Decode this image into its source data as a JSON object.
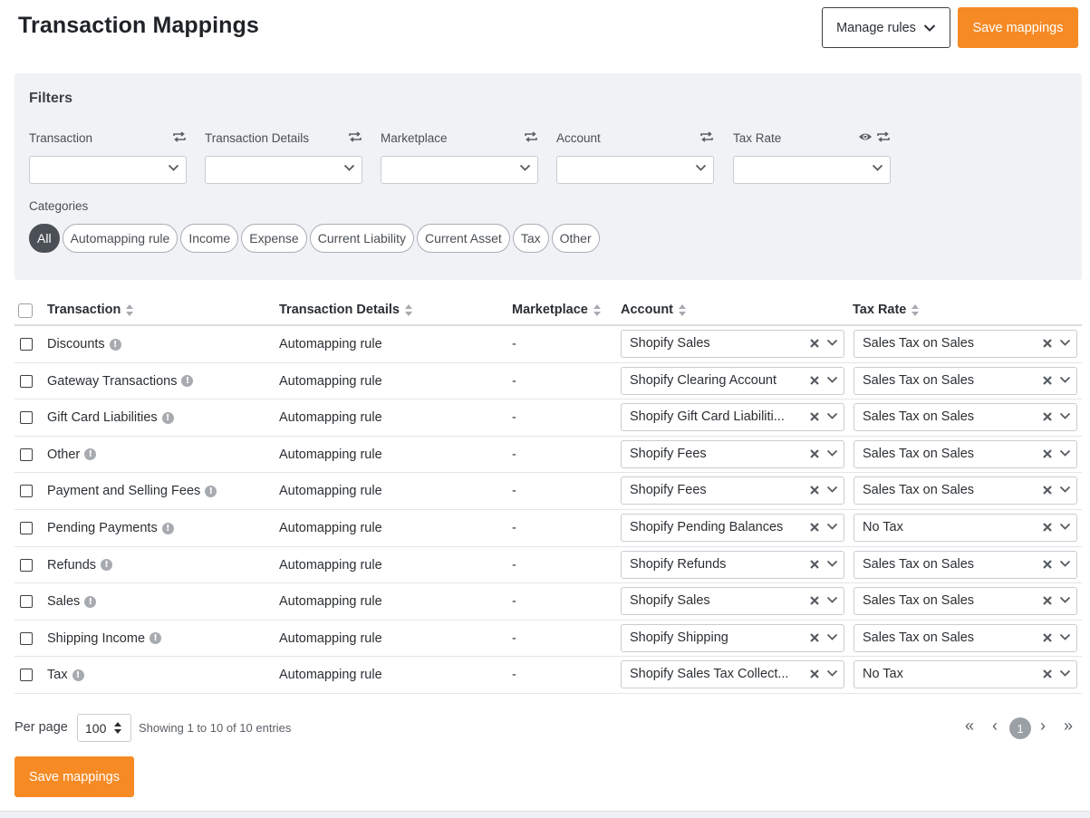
{
  "page": {
    "title": "Transaction Mappings",
    "manage_rules_label": "Manage rules",
    "save_label": "Save mappings",
    "accent_color": "#f68a24"
  },
  "filters": {
    "title": "Filters",
    "fields": [
      {
        "label": "Transaction",
        "icons": [
          "sync-icon"
        ]
      },
      {
        "label": "Transaction Details",
        "icons": [
          "sync-icon"
        ]
      },
      {
        "label": "Marketplace",
        "icons": [
          "sync-icon"
        ]
      },
      {
        "label": "Account",
        "icons": [
          "sync-icon"
        ]
      },
      {
        "label": "Tax Rate",
        "icons": [
          "eye-icon",
          "sync-icon"
        ]
      }
    ],
    "categories_label": "Categories",
    "categories": [
      "All",
      "Automapping rule",
      "Income",
      "Expense",
      "Current Liability",
      "Current Asset",
      "Tax",
      "Other"
    ],
    "active_category": "All"
  },
  "table": {
    "headers": [
      "Transaction",
      "Transaction Details",
      "Marketplace",
      "Account",
      "Tax Rate"
    ],
    "rows": [
      {
        "transaction": "Discounts",
        "details": "Automapping rule",
        "marketplace": "-",
        "account": "Shopify Sales",
        "tax": "Sales Tax on Sales"
      },
      {
        "transaction": "Gateway Transactions",
        "details": "Automapping rule",
        "marketplace": "-",
        "account": "Shopify Clearing Account",
        "tax": "Sales Tax on Sales"
      },
      {
        "transaction": "Gift Card Liabilities",
        "details": "Automapping rule",
        "marketplace": "-",
        "account": "Shopify Gift Card Liabiliti...",
        "tax": "Sales Tax on Sales"
      },
      {
        "transaction": "Other",
        "details": "Automapping rule",
        "marketplace": "-",
        "account": "Shopify Fees",
        "tax": "Sales Tax on Sales"
      },
      {
        "transaction": "Payment and Selling Fees",
        "details": "Automapping rule",
        "marketplace": "-",
        "account": "Shopify Fees",
        "tax": "Sales Tax on Sales"
      },
      {
        "transaction": "Pending Payments",
        "details": "Automapping rule",
        "marketplace": "-",
        "account": "Shopify Pending Balances",
        "tax": "No Tax"
      },
      {
        "transaction": "Refunds",
        "details": "Automapping rule",
        "marketplace": "-",
        "account": "Shopify Refunds",
        "tax": "Sales Tax on Sales"
      },
      {
        "transaction": "Sales",
        "details": "Automapping rule",
        "marketplace": "-",
        "account": "Shopify Sales",
        "tax": "Sales Tax on Sales"
      },
      {
        "transaction": "Shipping Income",
        "details": "Automapping rule",
        "marketplace": "-",
        "account": "Shopify Shipping",
        "tax": "Sales Tax on Sales"
      },
      {
        "transaction": "Tax",
        "details": "Automapping rule",
        "marketplace": "-",
        "account": "Shopify Sales Tax Collect...",
        "tax": "No Tax"
      }
    ]
  },
  "footer": {
    "per_page_label": "Per page",
    "per_page_value": "100",
    "showing": "Showing 1 to 10 of 10 entries",
    "pagination": {
      "first": "«",
      "prev": "‹",
      "current": "1",
      "next": "›",
      "last": "»"
    }
  }
}
